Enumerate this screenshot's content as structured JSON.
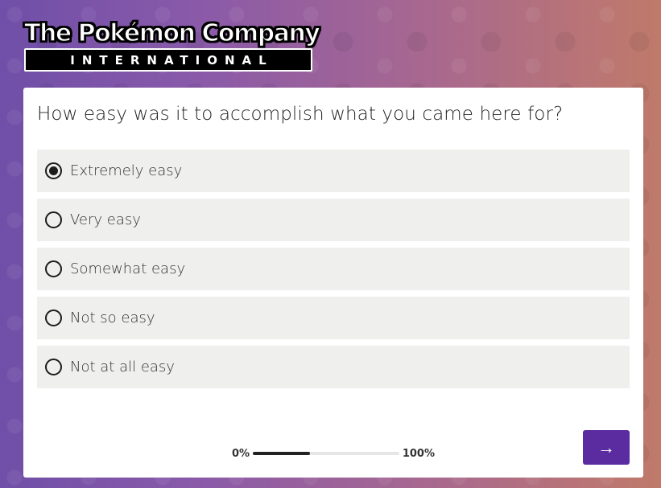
{
  "logo": {
    "top_text": "The Pokémon Company",
    "bottom_text": "INTERNATIONAL"
  },
  "survey": {
    "question": "How easy was it to accomplish what you came here for?",
    "options": [
      {
        "label": "Extremely easy",
        "selected": true
      },
      {
        "label": "Very easy",
        "selected": false
      },
      {
        "label": "Somewhat easy",
        "selected": false
      },
      {
        "label": "Not so easy",
        "selected": false
      },
      {
        "label": "Not at all easy",
        "selected": false
      }
    ]
  },
  "progress": {
    "start_label": "0%",
    "end_label": "100%",
    "value": 0.39
  },
  "next_button": {
    "icon": "arrow-right-icon",
    "glyph": "→",
    "color": "#5a2ca0"
  }
}
